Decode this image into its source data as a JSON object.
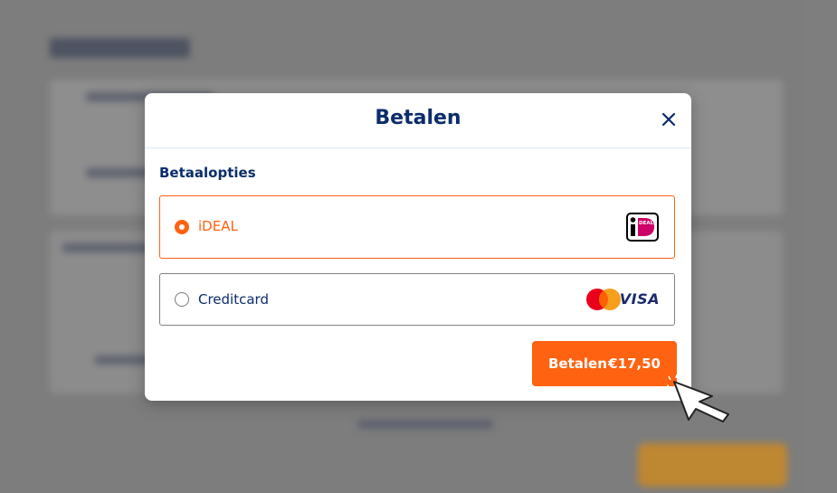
{
  "modal": {
    "title": "Betalen",
    "close_icon": "close-icon",
    "section_label": "Betaalopties",
    "options": [
      {
        "label": "iDEAL",
        "selected": true,
        "icon": "ideal-logo",
        "logo_text": "DEAL"
      },
      {
        "label": "Creditcard",
        "selected": false,
        "icons": [
          "mastercard-logo",
          "visa-logo"
        ],
        "visa_text": "VISA"
      }
    ],
    "pay_button": {
      "label": "Betalen",
      "amount": "€17,50"
    }
  },
  "colors": {
    "accent": "#ff6210",
    "heading": "#0b2d6b",
    "border": "#808080"
  }
}
